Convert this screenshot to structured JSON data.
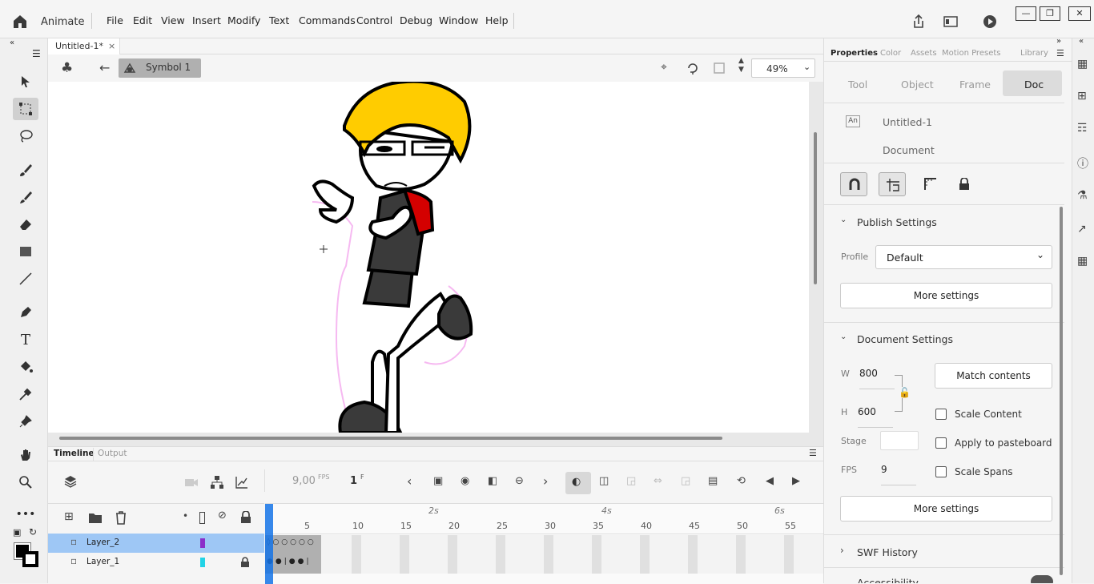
{
  "app": {
    "name": "Animate"
  },
  "menu": [
    "File",
    "Edit",
    "View",
    "Insert",
    "Modify",
    "Text",
    "Commands",
    "Control",
    "Debug",
    "Window",
    "Help"
  ],
  "document": {
    "tab_title": "Untitled-1*"
  },
  "editbar": {
    "symbol_label": "Symbol 1",
    "zoom": "49%"
  },
  "timeline": {
    "tabs": [
      "Timeline",
      "Output"
    ],
    "fps": "9,00",
    "fps_unit": "FPS",
    "frame": "1",
    "frame_unit": "F",
    "seconds_markers": [
      "2s",
      "4s",
      "6s"
    ],
    "frame_numbers": [
      "5",
      "10",
      "15",
      "20",
      "25",
      "30",
      "35",
      "40",
      "45",
      "50",
      "55"
    ],
    "layers": [
      {
        "name": "Layer_2",
        "color": "#8b2fc9",
        "selected": true,
        "locked": false
      },
      {
        "name": "Layer_1",
        "color": "#22d3e6",
        "selected": false,
        "locked": true
      }
    ]
  },
  "properties": {
    "panel_tabs": [
      "Properties",
      "Color",
      "Assets",
      "Motion Presets",
      "Library"
    ],
    "sub_tabs": [
      "Tool",
      "Object",
      "Frame",
      "Doc"
    ],
    "active_sub_tab": "Doc",
    "doc_badge": "An",
    "doc_name": "Untitled-1",
    "doc_type": "Document",
    "publish": {
      "title": "Publish Settings",
      "profile_label": "Profile",
      "profile_value": "Default",
      "more": "More settings"
    },
    "docsettings": {
      "title": "Document Settings",
      "w_label": "W",
      "w_value": "800",
      "h_label": "H",
      "h_value": "600",
      "match": "Match contents",
      "stage_label": "Stage",
      "fps_label": "FPS",
      "fps_value": "9",
      "scale_content": "Scale Content",
      "apply_pasteboard": "Apply to pasteboard",
      "scale_spans": "Scale Spans",
      "more": "More settings"
    },
    "swf_history": "SWF History",
    "accessibility": "Accessibility"
  },
  "colors": {
    "accent_blue": "#1473e6",
    "layer_selected": "#9ec7f5",
    "hair": "#ffcc00",
    "shirt_red": "#d40000"
  }
}
